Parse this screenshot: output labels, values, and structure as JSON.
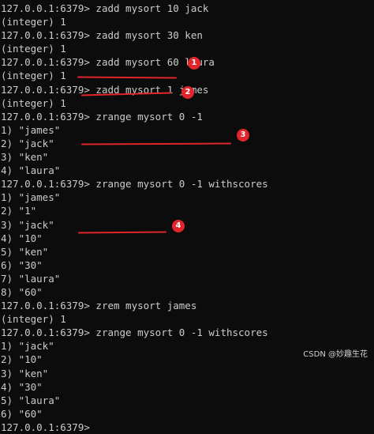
{
  "terminal": {
    "lines": [
      {
        "prompt": "127.0.0.1:6379>",
        "cmd": " zadd mysort 10 jack"
      },
      {
        "out": "(integer) 1"
      },
      {
        "prompt": "127.0.0.1:6379>",
        "cmd": " zadd mysort 30 ken"
      },
      {
        "out": "(integer) 1"
      },
      {
        "prompt": "127.0.0.1:6379>",
        "cmd": " zadd mysort 60 laura"
      },
      {
        "out": "(integer) 1"
      },
      {
        "prompt": "127.0.0.1:6379>",
        "cmd": " zadd mysort 1 james"
      },
      {
        "out": "(integer) 1"
      },
      {
        "prompt": "127.0.0.1:6379>",
        "cmd": " zrange mysort 0 -1"
      },
      {
        "out": "1) \"james\""
      },
      {
        "out": "2) \"jack\""
      },
      {
        "out": "3) \"ken\""
      },
      {
        "out": "4) \"laura\""
      },
      {
        "prompt": "127.0.0.1:6379>",
        "cmd": " zrange mysort 0 -1 withscores"
      },
      {
        "out": "1) \"james\""
      },
      {
        "out": "2) \"1\""
      },
      {
        "out": "3) \"jack\""
      },
      {
        "out": "4) \"10\""
      },
      {
        "out": "5) \"ken\""
      },
      {
        "out": "6) \"30\""
      },
      {
        "out": "7) \"laura\""
      },
      {
        "out": "8) \"60\""
      },
      {
        "prompt": "127.0.0.1:6379>",
        "cmd": " zrem mysort james"
      },
      {
        "out": "(integer) 1"
      },
      {
        "prompt": "127.0.0.1:6379>",
        "cmd": " zrange mysort 0 -1 withscores"
      },
      {
        "out": "1) \"jack\""
      },
      {
        "out": "2) \"10\""
      },
      {
        "out": "3) \"ken\""
      },
      {
        "out": "4) \"30\""
      },
      {
        "out": "5) \"laura\""
      },
      {
        "out": "6) \"60\""
      },
      {
        "prompt": "127.0.0.1:6379>",
        "cmd": ""
      }
    ]
  },
  "annotations": {
    "badge_1": "1",
    "badge_2": "2",
    "badge_3": "3",
    "badge_4": "4",
    "color": "#e0252b"
  },
  "watermark": "CSDN @妙趣生花"
}
